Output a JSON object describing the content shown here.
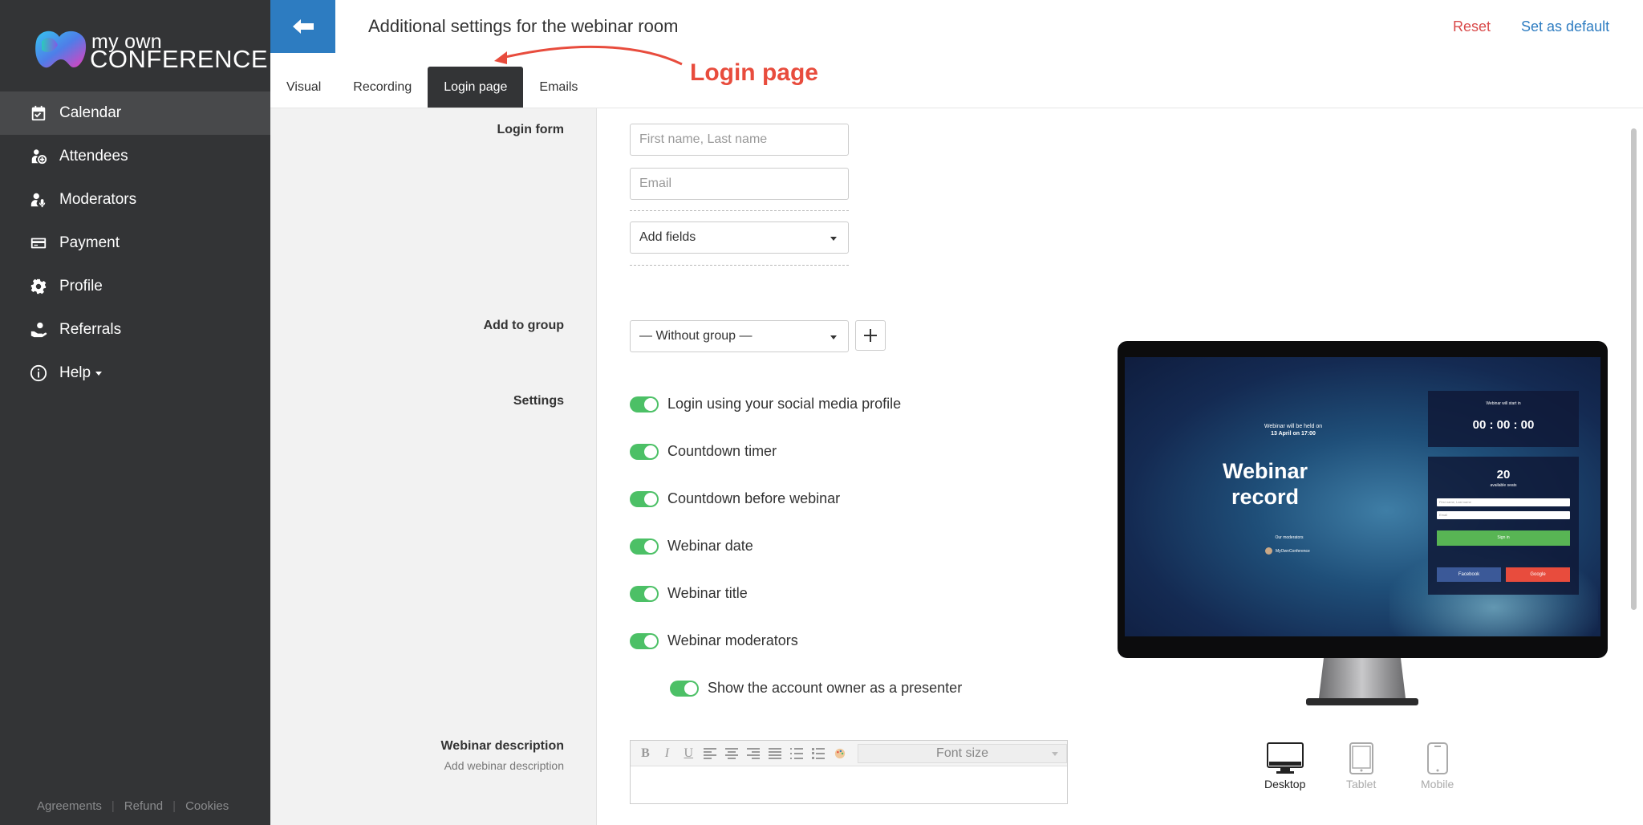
{
  "brand": {
    "line1": "my own",
    "line2": "CONFERENCE"
  },
  "sidebar": {
    "items": [
      {
        "label": "Calendar",
        "icon": "calendar-icon",
        "active": true
      },
      {
        "label": "Attendees",
        "icon": "attendees-icon",
        "active": false
      },
      {
        "label": "Moderators",
        "icon": "moderators-icon",
        "active": false
      },
      {
        "label": "Payment",
        "icon": "payment-icon",
        "active": false
      },
      {
        "label": "Profile",
        "icon": "gear-icon",
        "active": false
      },
      {
        "label": "Referrals",
        "icon": "referrals-icon",
        "active": false
      },
      {
        "label": "Help",
        "icon": "info-icon",
        "active": false
      }
    ],
    "footer": [
      "Agreements",
      "Refund",
      "Cookies"
    ]
  },
  "header": {
    "title": "Additional settings for the webinar room",
    "reset_label": "Reset",
    "default_label": "Set as default"
  },
  "tabs": [
    {
      "label": "Visual",
      "active": false
    },
    {
      "label": "Recording",
      "active": false
    },
    {
      "label": "Login page",
      "active": true
    },
    {
      "label": "Emails",
      "active": false
    }
  ],
  "annotation": {
    "text": "Login page",
    "color": "#e84c3d"
  },
  "login_form": {
    "label": "Login form",
    "name_placeholder": "First name, Last name",
    "email_placeholder": "Email",
    "add_fields_label": "Add fields"
  },
  "group": {
    "label": "Add to group",
    "selected": "— Without group —"
  },
  "settings": {
    "label": "Settings",
    "toggles": [
      {
        "label": "Login using your social media profile",
        "on": true
      },
      {
        "label": "Countdown timer",
        "on": true
      },
      {
        "label": "Countdown before webinar",
        "on": true
      },
      {
        "label": "Webinar date",
        "on": true
      },
      {
        "label": "Webinar title",
        "on": true
      },
      {
        "label": "Webinar moderators",
        "on": true
      },
      {
        "label": "Show the account owner as a presenter",
        "on": true
      }
    ]
  },
  "description": {
    "label": "Webinar description",
    "sublabel": "Add webinar description",
    "font_size_label": "Font size"
  },
  "preview": {
    "held_line1": "Webinar will be held on",
    "held_line2": "13 April on 17:00",
    "title_line1": "Webinar",
    "title_line2": "record",
    "moderators_caption": "Our moderators",
    "moderator_name": "MyOwnConference",
    "starts_caption": "Webinar will start in",
    "timer": "00 : 00 : 00",
    "seats": "20",
    "seats_caption": "available seats",
    "name_field": "First name, Last name",
    "email_field": "Email",
    "sign_in": "Sign in",
    "facebook": "Facebook",
    "google": "Google"
  },
  "devices": [
    {
      "label": "Desktop",
      "active": true
    },
    {
      "label": "Tablet",
      "active": false
    },
    {
      "label": "Mobile",
      "active": false
    }
  ],
  "colors": {
    "sidebar_bg": "#333436",
    "accent_blue": "#2d7cc1",
    "reset_red": "#d94a4a",
    "toggle_green": "#4cc066"
  }
}
